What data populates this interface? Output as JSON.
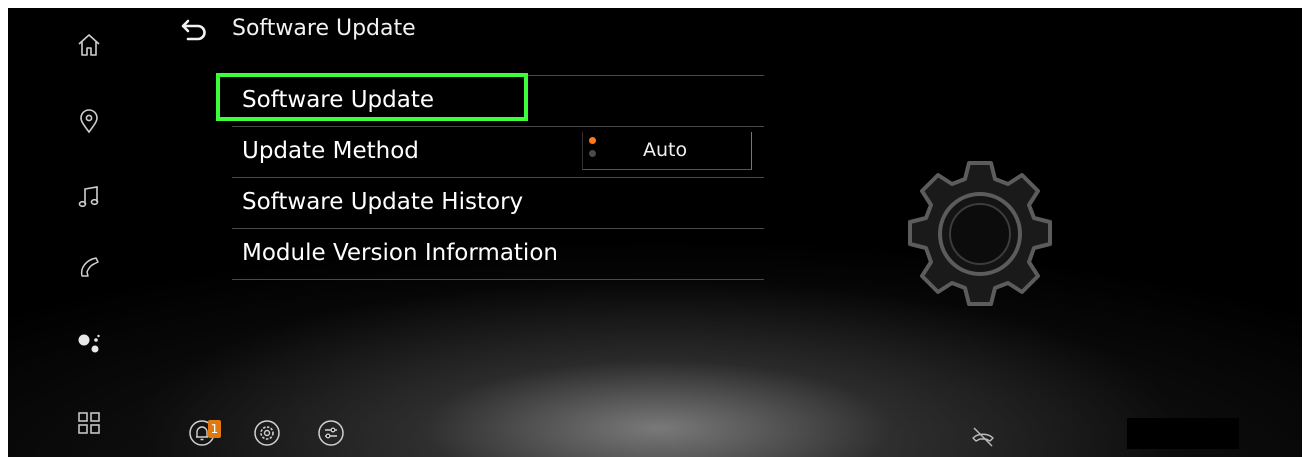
{
  "header": {
    "title": "Software Update"
  },
  "sidebar": {
    "items": [
      {
        "icon": "home-icon"
      },
      {
        "icon": "location-pin-icon"
      },
      {
        "icon": "music-note-icon"
      },
      {
        "icon": "phone-icon"
      },
      {
        "icon": "google-assistant-icon"
      },
      {
        "icon": "apps-grid-icon"
      }
    ]
  },
  "menu": {
    "items": [
      {
        "label": "Software Update",
        "highlighted": true
      },
      {
        "label": "Update Method",
        "value": "Auto"
      },
      {
        "label": "Software Update History"
      },
      {
        "label": "Module Version Information"
      }
    ]
  },
  "bottom_bar": {
    "notification_count": "1",
    "icons": [
      "notification-bell-icon",
      "settings-gear-icon",
      "sliders-icon",
      "phone-off-icon"
    ]
  },
  "colors": {
    "highlight": "#3bff3b",
    "accent": "#ff7a1a"
  }
}
